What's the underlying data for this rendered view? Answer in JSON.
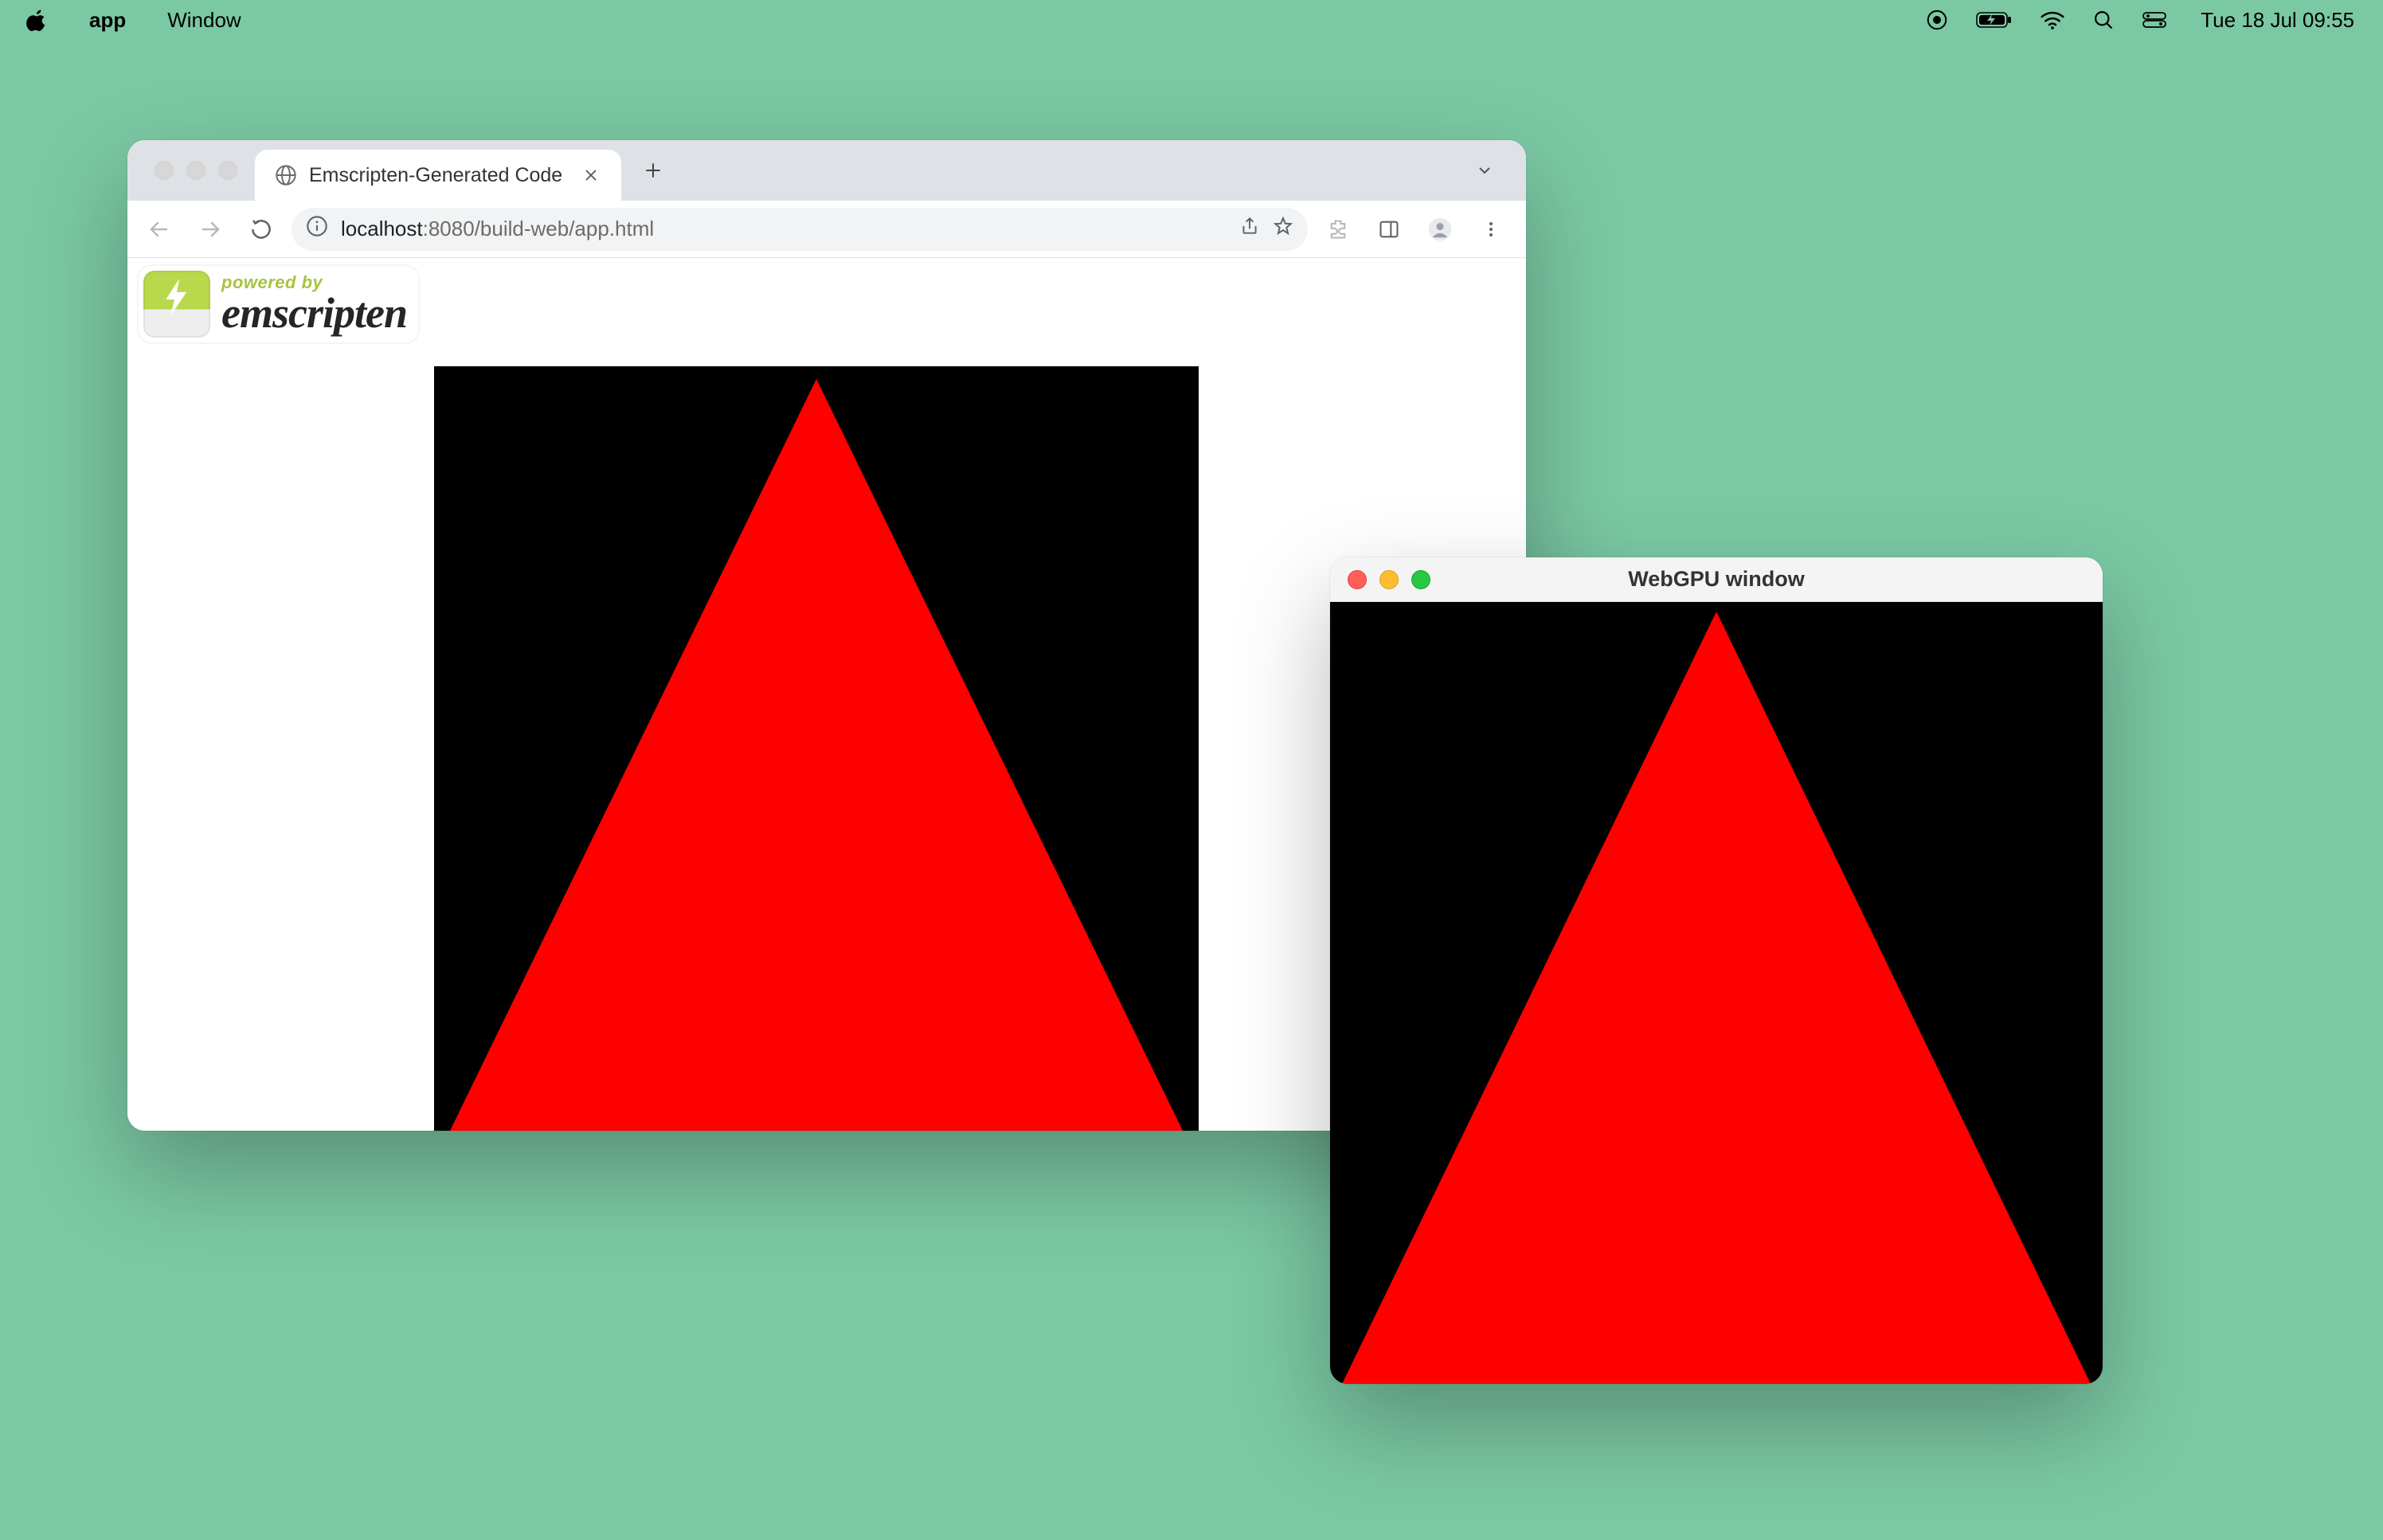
{
  "menubar": {
    "app_name": "app",
    "menus": [
      "Window"
    ],
    "clock": "Tue 18 Jul  09:55"
  },
  "chrome": {
    "tab_title": "Emscripten-Generated Code",
    "url_host": "localhost",
    "url_rest": ":8080/build-web/app.html"
  },
  "emscripten": {
    "tagline": "powered by",
    "brand": "emscripten"
  },
  "native_window": {
    "title": "WebGPU window"
  }
}
